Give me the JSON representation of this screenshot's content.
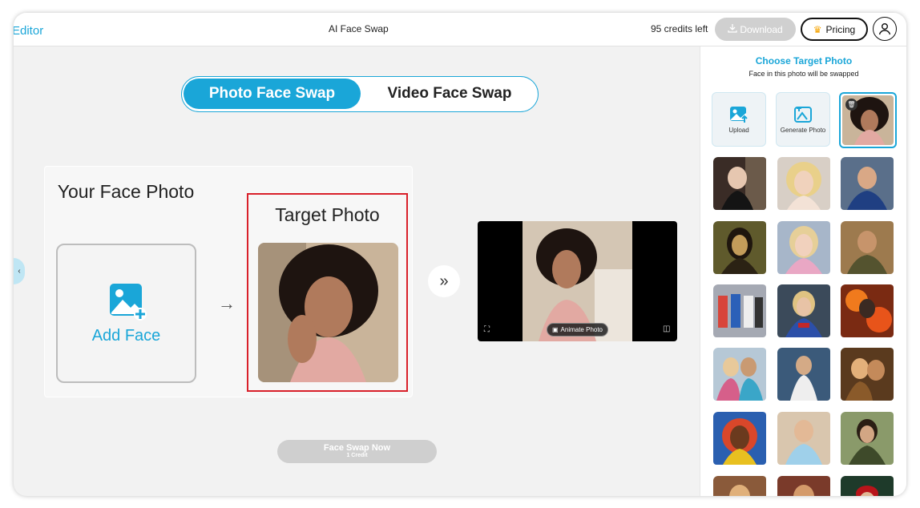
{
  "header": {
    "brand": "Editor",
    "app_title": "AI Face Swap",
    "credits": "95 credits left",
    "download_label": "Download",
    "pricing_label": "Pricing"
  },
  "tabs": [
    {
      "label": "Photo Face Swap",
      "active": true
    },
    {
      "label": "Video Face Swap",
      "active": false
    }
  ],
  "editor": {
    "your_face_title": "Your Face Photo",
    "add_face_label": "Add Face",
    "target_title": "Target Photo",
    "animate_label": "Animate Photo",
    "swap_button": "Face Swap Now",
    "swap_cost": "1 Credit"
  },
  "sidebar": {
    "title": "Choose Target Photo",
    "subtitle": "Face in this photo will be swapped",
    "upload_label": "Upload",
    "generate_label": "Generate Photo"
  },
  "colors": {
    "accent": "#1aa6d8",
    "highlight_border": "#d9202a"
  }
}
